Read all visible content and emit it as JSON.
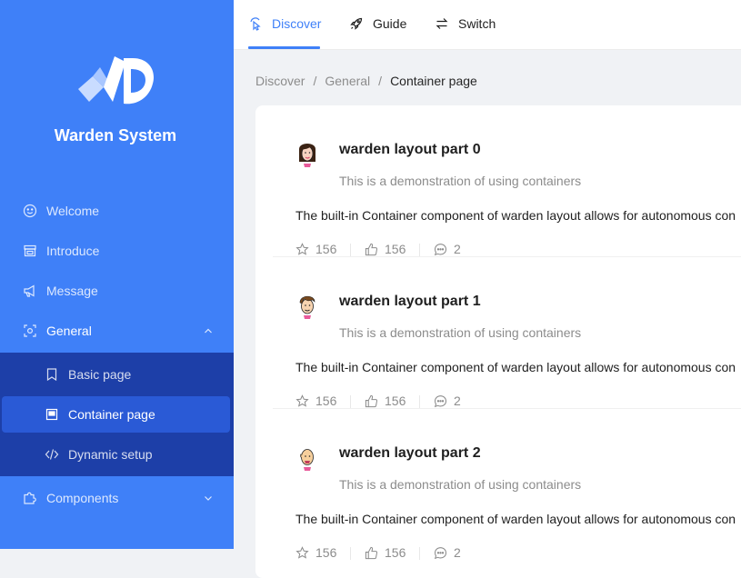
{
  "brand": {
    "name": "Warden System"
  },
  "sidebar": {
    "items": [
      {
        "label": "Welcome",
        "icon": "smile-icon"
      },
      {
        "label": "Introduce",
        "icon": "shop-icon"
      },
      {
        "label": "Message",
        "icon": "notification-icon"
      },
      {
        "label": "General",
        "icon": "scan-icon",
        "expanded": true
      },
      {
        "label": "Components",
        "icon": "puzzle-icon",
        "expanded": false
      }
    ],
    "submenu": [
      {
        "label": "Basic page",
        "icon": "book-icon"
      },
      {
        "label": "Container page",
        "icon": "container-icon",
        "active": true
      },
      {
        "label": "Dynamic setup",
        "icon": "code-icon"
      }
    ]
  },
  "topnav": {
    "tabs": [
      {
        "label": "Discover",
        "icon": "pointer-icon",
        "active": true
      },
      {
        "label": "Guide",
        "icon": "rocket-icon"
      },
      {
        "label": "Switch",
        "icon": "swap-icon"
      }
    ]
  },
  "breadcrumb": [
    "Discover",
    "General",
    "Container page"
  ],
  "breadcrumb_separator": "/",
  "articles": [
    {
      "title": "warden layout part 0",
      "description": "This is a demonstration of using containers",
      "body": "The built-in Container component of warden layout allows for autonomous con",
      "stars": "156",
      "likes": "156",
      "comments": "2",
      "avatar": "avatar-woman-icon"
    },
    {
      "title": "warden layout part 1",
      "description": "This is a demonstration of using containers",
      "body": "The built-in Container component of warden layout allows for autonomous con",
      "stars": "156",
      "likes": "156",
      "comments": "2",
      "avatar": "avatar-man-icon"
    },
    {
      "title": "warden layout part 2",
      "description": "This is a demonstration of using containers",
      "body": "The built-in Container component of warden layout allows for autonomous con",
      "stars": "156",
      "likes": "156",
      "comments": "2",
      "avatar": "avatar-bald-icon"
    }
  ],
  "colors": {
    "sidebar": "#3f80f8",
    "submenu": "#1d3fa8",
    "active_item": "#2a5ad6",
    "accent": "#3f80f8"
  }
}
